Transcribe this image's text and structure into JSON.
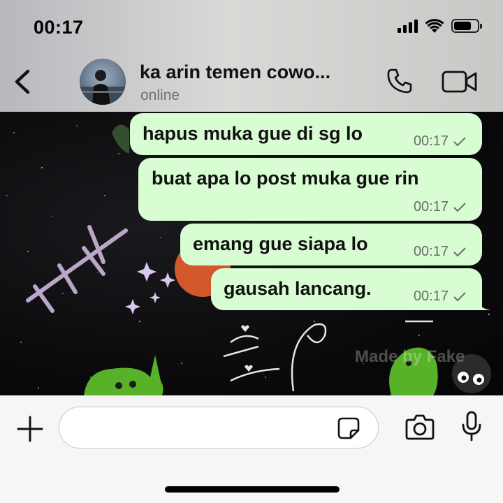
{
  "status_bar": {
    "time": "00:17",
    "icons": [
      "signal-icon",
      "wifi-icon",
      "battery-icon"
    ],
    "battery_level": 0.75
  },
  "header": {
    "contact_name": "ka arin temen cowo...",
    "contact_status": "online",
    "icons": [
      "back-chevron-icon",
      "avatar",
      "phone-icon",
      "video-camera-icon"
    ]
  },
  "messages": [
    {
      "text": "hapus muka gue di sg lo",
      "time": "00:17",
      "status_icon": "single-check-icon",
      "outgoing": true
    },
    {
      "text": "buat apa lo post muka gue rin",
      "time": "00:17",
      "status_icon": "single-check-icon",
      "outgoing": true
    },
    {
      "text": "emang gue siapa lo",
      "time": "00:17",
      "status_icon": "single-check-icon",
      "outgoing": true
    },
    {
      "text": "gausah lancang.",
      "time": "00:17",
      "status_icon": "single-check-icon",
      "outgoing": true
    }
  ],
  "wallpaper": {
    "watermark": "Made by Fake"
  },
  "input_bar": {
    "message_value": "",
    "icons": [
      "plus-icon",
      "sticker-icon",
      "camera-icon",
      "microphone-icon"
    ]
  },
  "colors": {
    "bubble_outgoing": "#d9fdd3",
    "header_bg": "#d1d3d0",
    "chat_bg": "#0b0b0d",
    "meta_text": "#6b6b6b",
    "status_text": "#707070"
  }
}
